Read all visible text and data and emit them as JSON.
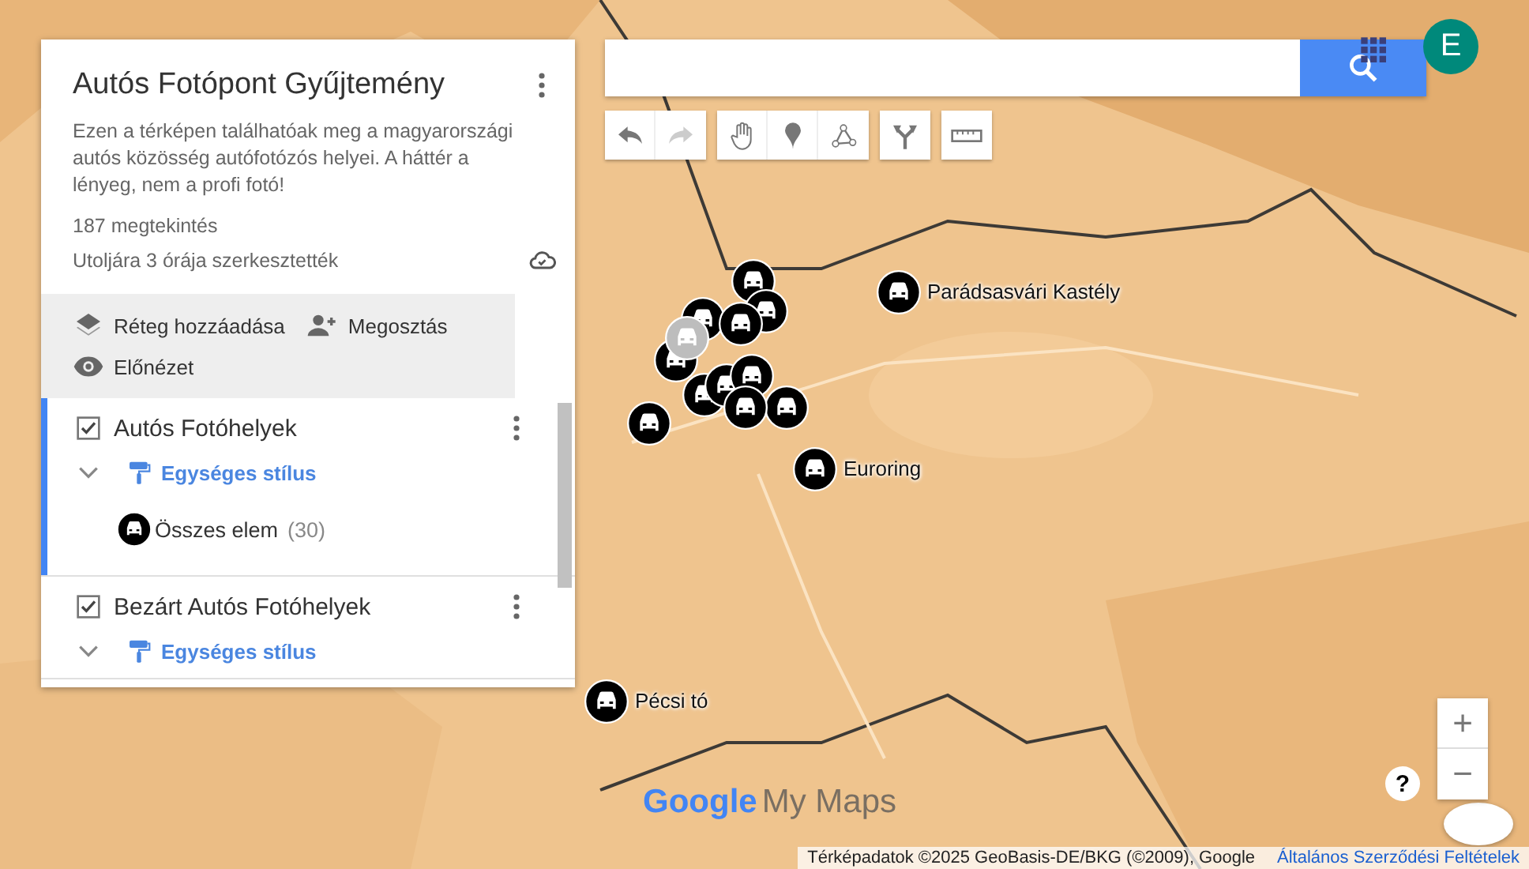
{
  "panel": {
    "title": "Autós Fotópont Gyűjtemény",
    "description": "Ezen a térképen találhatóak meg a magyarországi autós közösség autófotózós helyei. A háttér a lényeg, nem a profi fotó!",
    "views": "187 megtekintés",
    "last_edited": "Utoljára 3 órája szerkesztették",
    "actions": [
      {
        "kind": "add_layer",
        "label": "Réteg hozzáadása"
      },
      {
        "kind": "share",
        "label": "Megosztás"
      },
      {
        "kind": "preview",
        "label": "Előnézet"
      }
    ],
    "layers": [
      {
        "title": "Autós Fotóhelyek",
        "checked": true,
        "selected": true,
        "style_label": "Egységes stílus",
        "items": [
          {
            "label": "Összes elem",
            "count": "(30)"
          }
        ]
      },
      {
        "title": "Bezárt Autós Fotóhelyek",
        "checked": true,
        "selected": false,
        "style_label": "Egységes stílus"
      }
    ]
  },
  "toolbar": [
    {
      "kind": "undo",
      "disabled": false
    },
    {
      "kind": "redo",
      "disabled": true
    },
    {
      "kind": "hand",
      "disabled": false
    },
    {
      "kind": "pin",
      "disabled": false
    },
    {
      "kind": "line",
      "disabled": false
    },
    {
      "kind": "route",
      "disabled": false
    },
    {
      "kind": "ruler",
      "disabled": false
    }
  ],
  "account": {
    "initial": "E"
  },
  "markers": [
    {
      "label": "Parádsasvári Kastély",
      "dimmed": false
    },
    {
      "label": "Euroring",
      "dimmed": false
    },
    {
      "label": "Pécsi tó",
      "dimmed": false
    },
    {
      "dimmed": false
    },
    {
      "dimmed": false
    },
    {
      "dimmed": false
    },
    {
      "dimmed": false
    },
    {
      "dimmed": true
    },
    {
      "dimmed": false
    },
    {
      "dimmed": false
    },
    {
      "dimmed": false
    },
    {
      "dimmed": false
    },
    {
      "dimmed": false
    },
    {
      "dimmed": false
    },
    {
      "dimmed": false
    }
  ],
  "zoom": {
    "in": "+",
    "out": "−"
  },
  "help": "?",
  "logo": {
    "brand": "Google",
    "product": "My Maps"
  },
  "attribution": {
    "text": "Térképadatok ©2025 GeoBasis-DE/BKG (©2009), Google",
    "link": "Általános Szerződési Feltételek"
  }
}
